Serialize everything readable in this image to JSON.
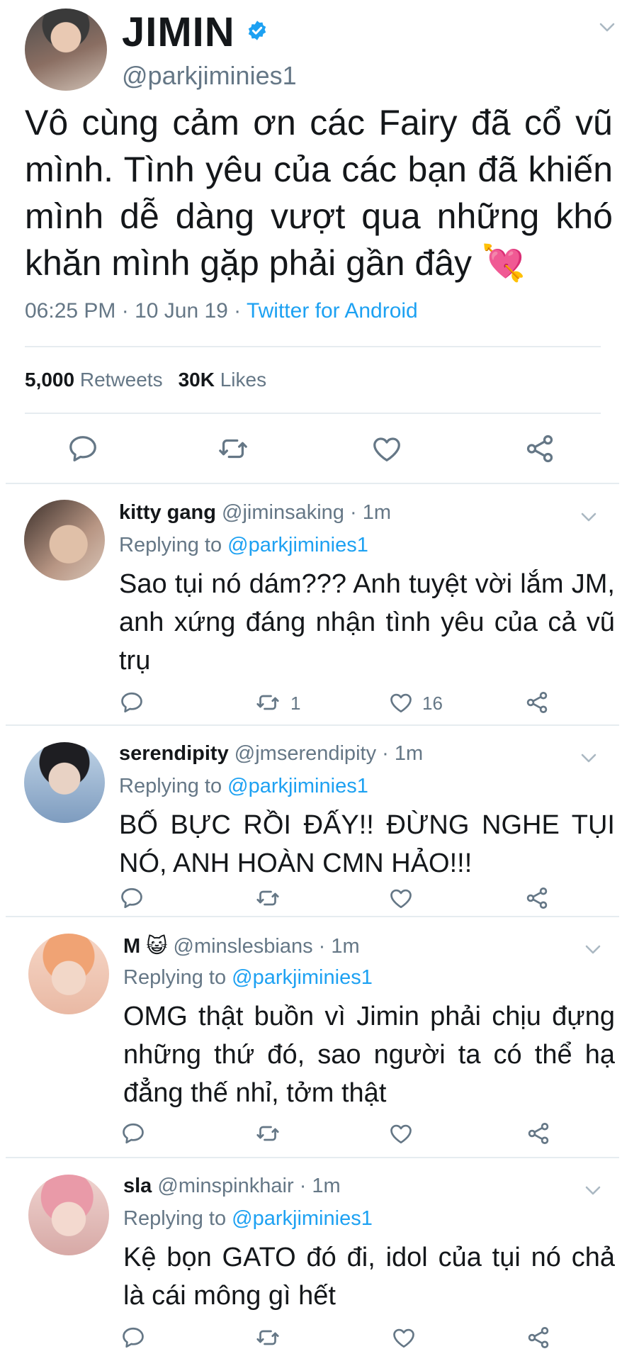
{
  "main_tweet": {
    "name": "JIMIN",
    "handle": "@parkjiminies1",
    "text": "Vô cùng cảm ơn các Fairy đã cổ vũ mình. Tình yêu của các bạn đã khiến mình dễ dàng vượt qua những khó khăn mình gặp phải gần đây 💘",
    "time": "06:25 PM · 10 Jun 19 · ",
    "source": "Twitter for Android",
    "retweets_count": "5,000",
    "retweets_label": "Retweets",
    "likes_count": "30K",
    "likes_label": "Likes"
  },
  "replies": [
    {
      "name": "kitty gang",
      "handle": "@jiminsaking",
      "time": "· 1m",
      "replying_label": "Replying to",
      "replying_to": "@parkjiminies1",
      "text": "Sao tụi nó dám??? Anh tuyệt vời lắm JM, anh xứng đáng nhận tình yêu của cả vũ trụ",
      "retweets": "1",
      "likes": "16"
    },
    {
      "name": "serendipity",
      "handle": "@jmserendipity",
      "time": "· 1m",
      "replying_label": "Replying to",
      "replying_to": "@parkjiminies1",
      "text": "BỐ BỰC RỒI ĐẤY!! ĐỪNG NGHE TỤI NÓ, ANH HOÀN CMN HẢO!!!",
      "retweets": "",
      "likes": ""
    },
    {
      "name": "M 😺",
      "handle": "@minslesbians",
      "time": "· 1m",
      "replying_label": "Replying to",
      "replying_to": "@parkjiminies1",
      "text": "OMG thật buồn vì Jimin phải chịu đựng những thứ đó, sao người ta có thể hạ đẳng thế nhỉ, tởm thật",
      "retweets": "",
      "likes": ""
    },
    {
      "name": "sla",
      "handle": "@minspinkhair",
      "time": "· 1m",
      "replying_label": "Replying to",
      "replying_to": "@parkjiminies1",
      "text": "Kệ bọn GATO đó đi, idol của tụi nó chả là cái mông gì hết",
      "retweets": "",
      "likes": ""
    }
  ],
  "icons": {
    "reply": "reply-icon",
    "retweet": "retweet-icon",
    "like": "heart-icon",
    "share": "share-icon",
    "caret": "chevron-down-icon",
    "verified": "verified-badge-icon"
  },
  "colors": {
    "accent": "#1da1f2",
    "muted": "#657786",
    "text": "#14171a",
    "divider": "#e6ecf0"
  }
}
